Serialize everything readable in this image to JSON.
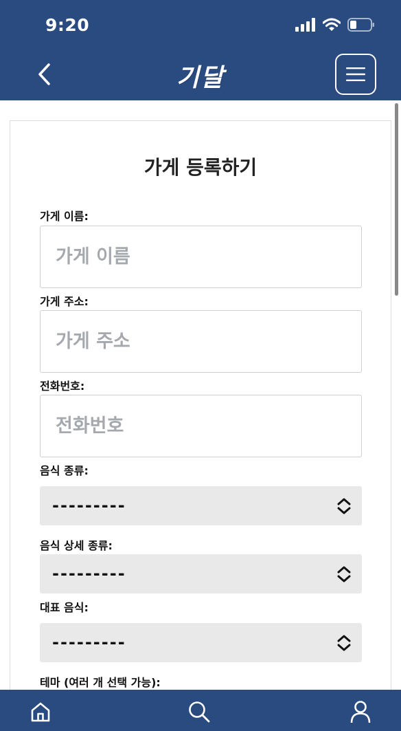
{
  "status_bar": {
    "time": "9:20"
  },
  "header": {
    "logo": "기달",
    "back_icon": "chevron-left-icon",
    "menu_icon": "hamburger-menu-icon"
  },
  "form": {
    "title": "가게 등록하기",
    "store_name": {
      "label": "가게 이름:",
      "placeholder": "가게 이름"
    },
    "store_address": {
      "label": "가게 주소:",
      "placeholder": "가게 주소"
    },
    "phone": {
      "label": "전화번호:",
      "placeholder": "전화번호"
    },
    "food_type": {
      "label": "음식 종류:",
      "value": "---------"
    },
    "food_detail_type": {
      "label": "음식 상세 종류:",
      "value": "---------"
    },
    "signature_food": {
      "label": "대표 음식:",
      "value": "---------"
    },
    "theme": {
      "label": "테마 (여러 개 선택 가능):"
    }
  },
  "bottom_nav": {
    "items": [
      "home-icon",
      "search-icon",
      "user-icon"
    ]
  },
  "colors": {
    "primary": "#2a4b80",
    "select_bg": "#e9e9e9",
    "placeholder": "#a5a9ae"
  }
}
